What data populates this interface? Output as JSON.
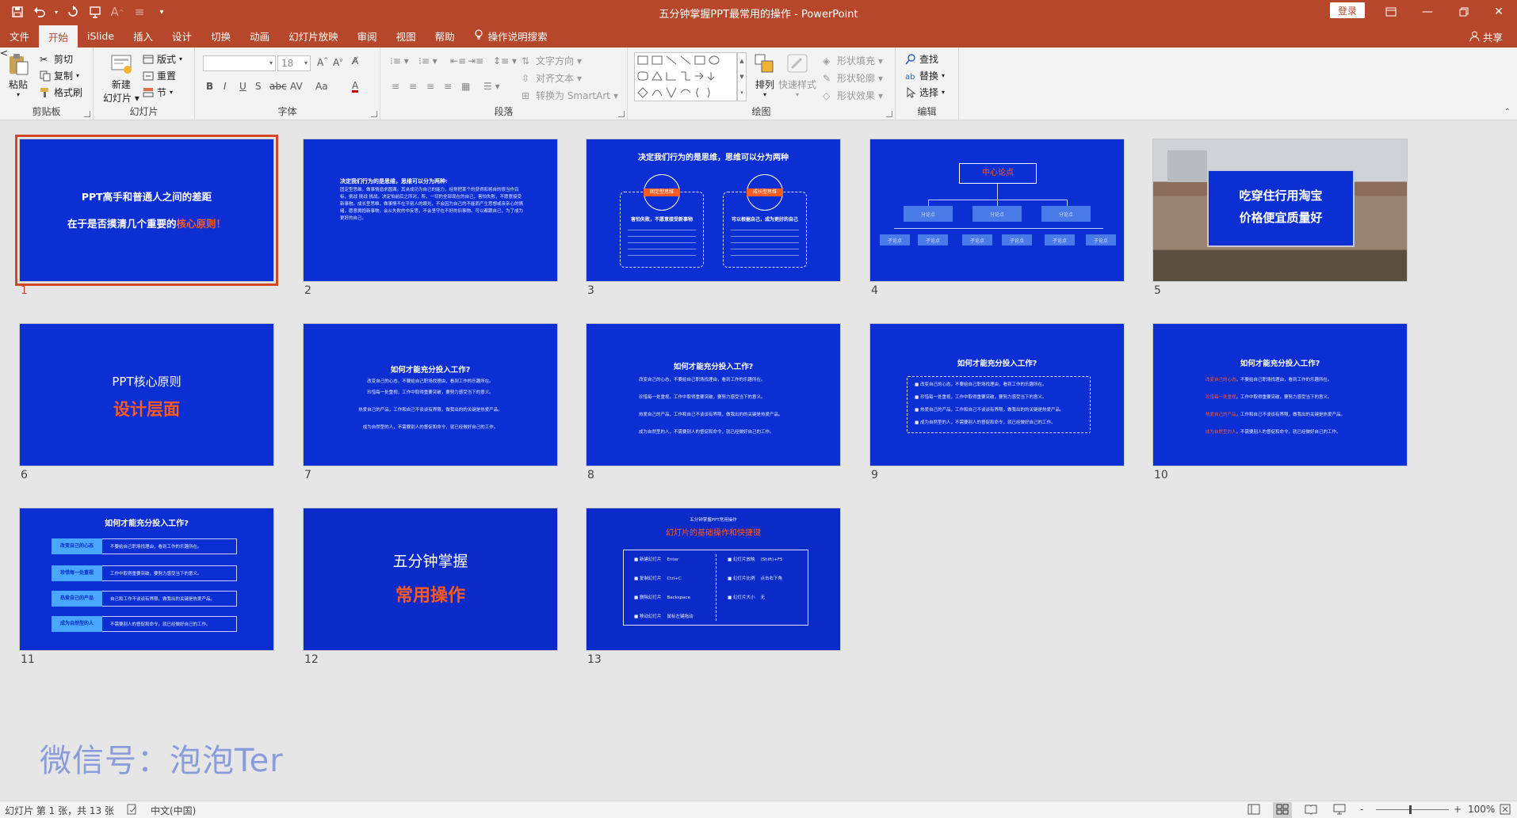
{
  "titlebar": {
    "title": "五分钟掌握PPT最常用的操作  -  PowerPoint",
    "login": "登录",
    "qat_icons": [
      "save-icon",
      "undo-icon",
      "redo-icon",
      "start-from-beginning-icon",
      "font-grow-icon",
      "spacing-icon",
      "customize-icon"
    ]
  },
  "tabs": [
    {
      "label": "文件"
    },
    {
      "label": "开始"
    },
    {
      "label": "iSlide"
    },
    {
      "label": "插入"
    },
    {
      "label": "设计"
    },
    {
      "label": "切换"
    },
    {
      "label": "动画"
    },
    {
      "label": "幻灯片放映"
    },
    {
      "label": "审阅"
    },
    {
      "label": "视图"
    },
    {
      "label": "帮助"
    },
    {
      "label": "操作说明搜索"
    }
  ],
  "share": "共享",
  "ribbon": {
    "clipboard": {
      "label": "剪贴板",
      "paste": "粘贴",
      "cut": "剪切",
      "copy": "复制",
      "format_painter": "格式刷"
    },
    "slides": {
      "label": "幻灯片",
      "new_slide": "新建",
      "new_slide2": "幻灯片",
      "layout": "版式",
      "reset": "重置",
      "section": "节"
    },
    "font": {
      "label": "字体",
      "font_name": "",
      "font_size": "18",
      "bold": "B",
      "italic": "I",
      "underline": "U",
      "shadow": "S",
      "strike": "abc",
      "spacing": "AV",
      "case": "Aa",
      "color": "A"
    },
    "paragraph": {
      "label": "段落",
      "text_direction": "文字方向",
      "align_text": "对齐文本",
      "smartart": "转换为 SmartArt"
    },
    "drawing": {
      "label": "绘图",
      "arrange": "排列",
      "quick_styles": "快速样式",
      "shape_fill": "形状填充",
      "shape_outline": "形状轮廓",
      "shape_effects": "形状效果"
    },
    "editing": {
      "label": "编辑",
      "find": "查找",
      "replace": "替换",
      "select": "选择"
    }
  },
  "slides": [
    {
      "num": "1",
      "line1": "PPT高手和普通人之间的差距",
      "line2a": "在于是否摸清几个重要的",
      "line2b": "核心原则！"
    },
    {
      "num": "2",
      "title": "决定我们行为的是思维，思维可以分为两种:",
      "body": "固定型思维，做事情追求圆满。其夹成功为自己的能力，经常把某个的获得和将自的很当作目标，挑战 挑战 挑战，决定怕前后之所对，所，一切的全部现在的自己，害怕失败，不愿意接受新事物。成长型思维，做事情不在乎别人的眼光，不会因为自己的不能而产生思想或亲亲心的情绪，愿意拥抱新事物，会从失败的中反思，不会坚守在不好的旧事物。可以都跟自己，为了成为更好的自己。"
    },
    {
      "num": "3",
      "title": "决定我们行为的是思维，思维可以分为两种",
      "left_head": "固定型思维",
      "left_sub": "害怕失败，不愿意接受新事物",
      "right_head": "成长型思维",
      "right_sub": "可以根据自己，成为更好的自己"
    },
    {
      "num": "4",
      "center": "中心论点",
      "branches": [
        "分论点",
        "分论点",
        "分论点"
      ],
      "leaves": [
        "子论点",
        "子论点",
        "子论点",
        "子论点",
        "子论点",
        "子论点"
      ]
    },
    {
      "num": "5",
      "line1": "吃穿住行用淘宝",
      "line2": "价格便宜质量好"
    },
    {
      "num": "6",
      "line1": "PPT核心原则",
      "line2": "设计层面"
    },
    {
      "num": "7",
      "title": "如何才能充分投入工作?",
      "lines": [
        "改变自己的心态，不要给自己职场找理由，看到工作的乐趣所在。",
        "珍惜每一处重视，工作中取得重要突破，要努力感受当下的意义。",
        "热爱自己的产品，工作和自己不谈谈有界限，做我出的的关键是热爱产品。",
        "成为自然型的人，不需要别人的督促和命令，就已经做好自己的工作。"
      ]
    },
    {
      "num": "8",
      "title": "如何才能充分投入工作?",
      "lines": [
        "改变自己的心态，不要给自己职场找理由，看到工作的乐趣所在。",
        "珍惜每一处重视，工作中取得重要突破，要努力感受当下的意义。",
        "热爱自己的产品，工作和自己不谈谈有界限，做我出的的关键是热爱产品。",
        "成为自然型的人，不需要别人的督促和命令，就已经做好自己的工作。"
      ]
    },
    {
      "num": "9",
      "title": "如何才能充分投入工作?",
      "lines": [
        "改变自己的心态，不要给自己职场找理由，看到工作的乐趣所在。",
        "珍惜每一处重视，工作中取得重要突破，要努力感受当下的意义。",
        "热爱自己的产品，工作和自己不谈谈有界限，做我出的的关键是热爱产品。",
        "成为自然型的人，不需要别人的督促和命令，就已经做好自己的工作。"
      ]
    },
    {
      "num": "10",
      "title": "如何才能充分投入工作?",
      "keys": [
        "改变自己的心态",
        "珍惜每一处重视",
        "热爱自己的产品",
        "成为自然型的人"
      ],
      "rests": [
        "，不要给自己职场找理由，看到工作的乐趣所在。",
        "，工作中取得重要突破，要努力感受当下的意义。",
        "，工作和自己不谈谈有界限，做我出的关键是热爱产品。",
        "，不需要别人的督促和命令，就已经做好自己的工作。"
      ]
    },
    {
      "num": "11",
      "title": "如何才能充分投入工作?",
      "keys": [
        "改变自己的心态",
        "珍惜每一处重视",
        "热爱自己的产品",
        "成为自然型的人"
      ],
      "rests": [
        "不要给自己职场找理由，看到工作的乐趣所在。",
        "工作中取得重要突破，要努力感受当下的意义。",
        "自己和工作不谈谈有界限，做我出的关键是热爱产品。",
        "不需要别人的督促和命令，就已经做好自己的工作。"
      ]
    },
    {
      "num": "12",
      "line1": "五分钟掌握",
      "line2": "常用操作"
    },
    {
      "num": "13",
      "small": "五分钟掌握PPT常用操作",
      "title": "幻灯片的基础操作和快捷键",
      "left": [
        [
          "新建幻灯片",
          "Enter"
        ],
        [
          "复制幻灯片",
          "Ctrl+C"
        ],
        [
          "删除幻灯片",
          "Backspace"
        ],
        [
          "移动幻灯片",
          "鼠标左键拖动"
        ]
      ],
      "right": [
        [
          "幻灯片放映",
          "(Shift)+F5"
        ],
        [
          "幻灯片比例",
          "点击右下角"
        ],
        [
          "幻灯片大小",
          "无"
        ]
      ]
    }
  ],
  "watermark": "微信号：泡泡Ter",
  "status": {
    "slide_info": "幻灯片 第 1 张，共 13 张",
    "language": "中文(中国)",
    "zoom": "100%",
    "zoom_minus": "-",
    "zoom_plus": "+"
  }
}
